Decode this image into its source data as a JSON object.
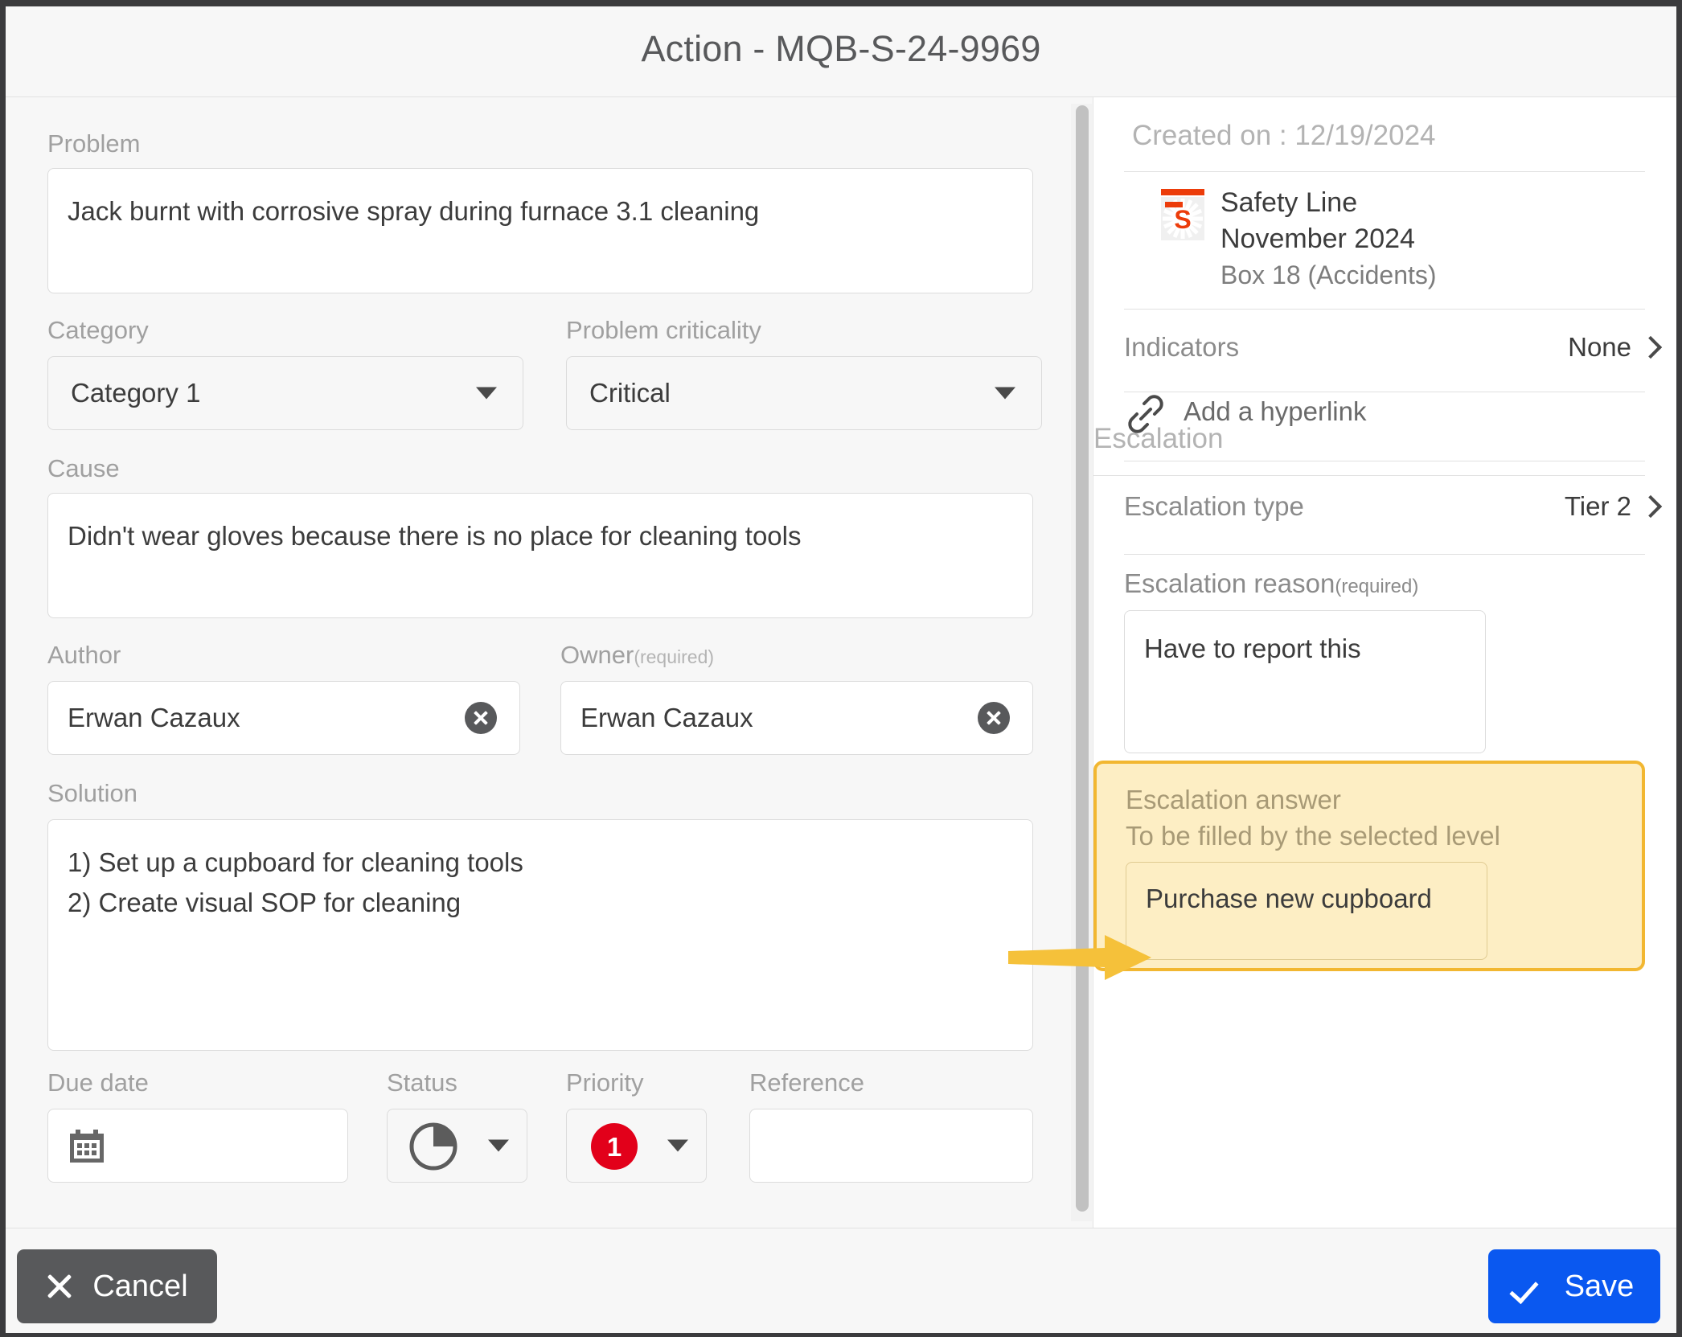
{
  "dialog": {
    "title": "Action - MQB-S-24-9969"
  },
  "form": {
    "problem": {
      "label": "Problem",
      "value": "Jack burnt with corrosive spray during furnace 3.1 cleaning"
    },
    "category": {
      "label": "Category",
      "value": "Category 1"
    },
    "criticality": {
      "label": "Problem criticality",
      "value": "Critical"
    },
    "cause": {
      "label": "Cause",
      "value": "Didn't wear gloves because there is no place for cleaning tools"
    },
    "author": {
      "label": "Author",
      "value": "Erwan Cazaux"
    },
    "owner": {
      "label": "Owner",
      "required_suffix": "(required)",
      "value": "Erwan Cazaux"
    },
    "solution": {
      "label": "Solution",
      "value": "1) Set up a cupboard for cleaning tools\n2) Create visual SOP for cleaning"
    },
    "due_date": {
      "label": "Due date",
      "value": "",
      "icon": "calendar-icon"
    },
    "status": {
      "label": "Status",
      "icon": "pie-quarter-icon"
    },
    "priority": {
      "label": "Priority",
      "value": "1",
      "badge_color": "#e2001a"
    },
    "reference": {
      "label": "Reference",
      "value": ""
    }
  },
  "sidebar": {
    "created_on": "Created on : 12/19/2024",
    "source": {
      "icon": "safety-line-icon",
      "name": "Safety Line",
      "period": "November 2024",
      "box": "Box 18 (Accidents)"
    },
    "indicators": {
      "label": "Indicators",
      "value": "None",
      "chevron": "chevron-right-icon"
    },
    "hyperlink": {
      "icon": "link-icon",
      "label": "Add a hyperlink"
    },
    "escalation": {
      "section_title": "Escalation",
      "type": {
        "label": "Escalation type",
        "value": "Tier 2",
        "chevron": "chevron-right-icon"
      },
      "reason": {
        "label": "Escalation reason",
        "required_suffix": "(required)",
        "value": "Have to report this"
      },
      "answer": {
        "label": "Escalation answer",
        "sublabel": "To be filled by the selected level",
        "value": "Purchase new cupboard",
        "highlight_border": "#f2b731",
        "highlight_fill": "#fdeec4"
      }
    }
  },
  "footer": {
    "cancel_label": "Cancel",
    "cancel_icon": "close-x-icon",
    "save_label": "Save",
    "save_icon": "check-icon",
    "save_color": "#0a58f0"
  },
  "annotation": {
    "arrow_color": "#f5c13a",
    "arrow_icon": "arrow-right-annotation"
  }
}
